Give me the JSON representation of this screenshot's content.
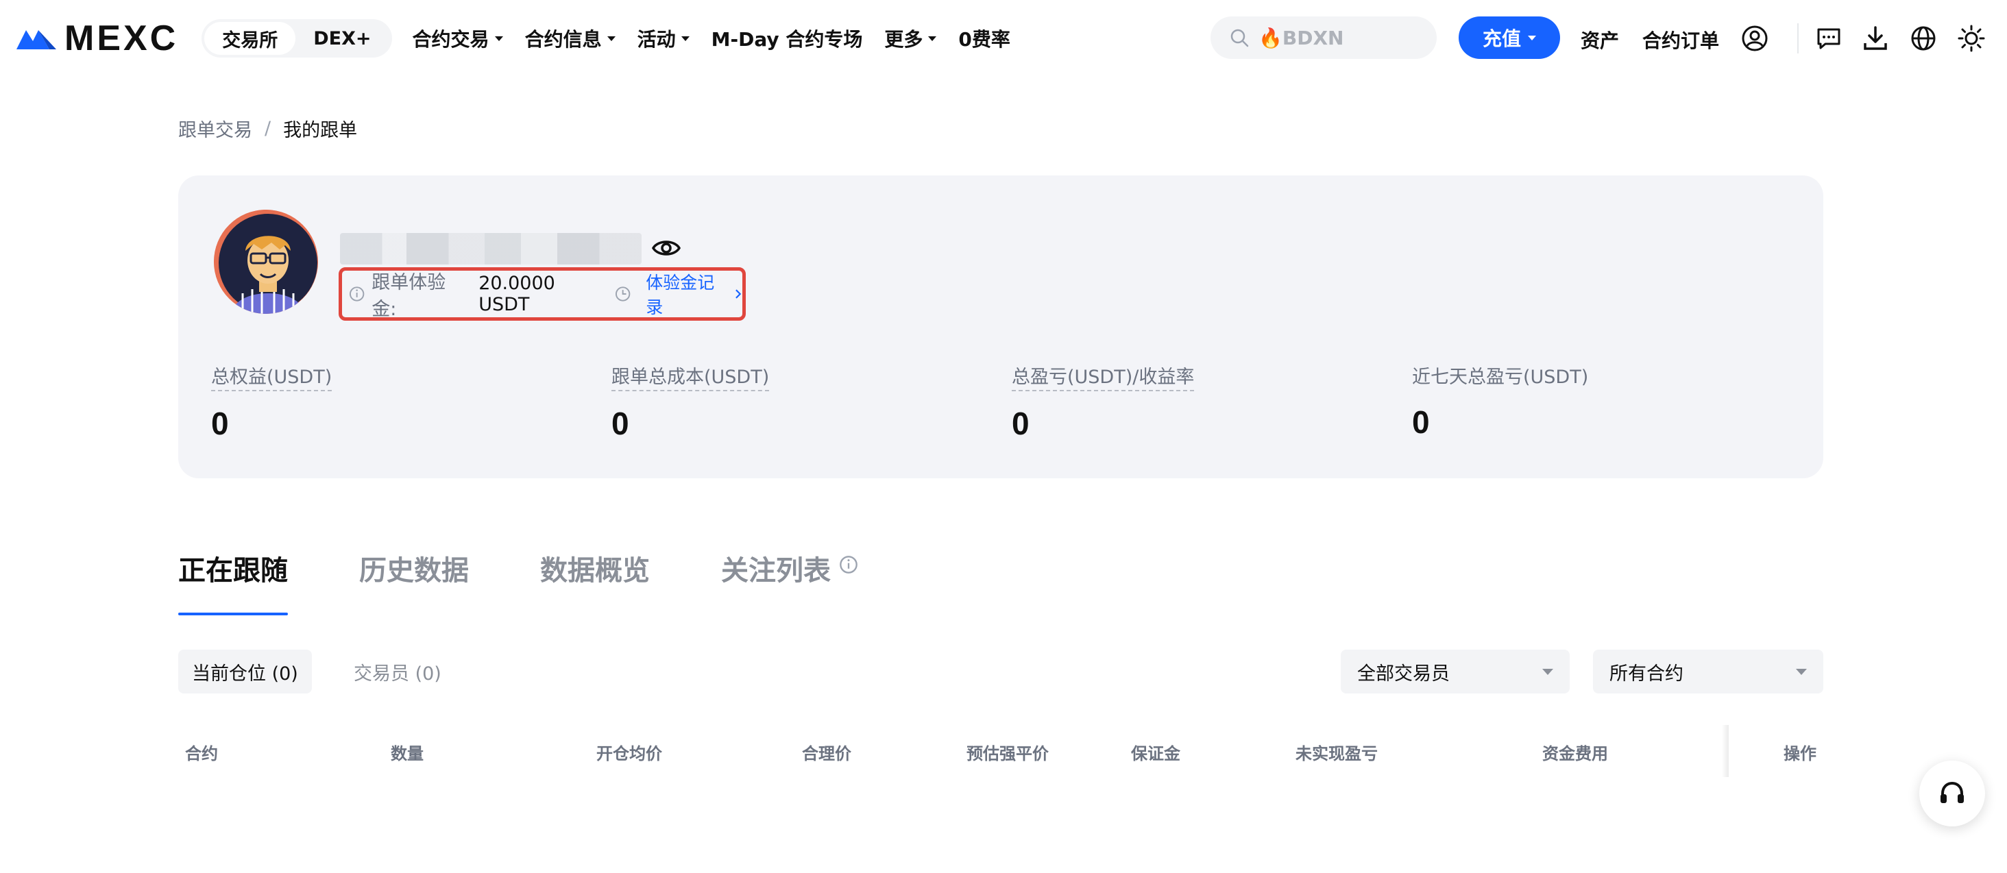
{
  "brand": {
    "name": "MEXC",
    "accent": "#1763ff",
    "highlight_border": "#e0463e"
  },
  "nav": {
    "segments": [
      {
        "label": "交易所",
        "active": true
      },
      {
        "label": "DEX+",
        "active": false
      }
    ],
    "menu": [
      {
        "label": "合约交易",
        "dropdown": true
      },
      {
        "label": "合约信息",
        "dropdown": true
      },
      {
        "label": "活动",
        "dropdown": true
      },
      {
        "label": "M-Day 合约专场",
        "dropdown": false
      },
      {
        "label": "更多",
        "dropdown": true
      },
      {
        "label": "0费率",
        "dropdown": false
      }
    ],
    "search_value": "🔥BDXN",
    "deposit_label": "充值",
    "assets_label": "资产",
    "orders_label": "合约订单",
    "icons": [
      "user-icon",
      "message-icon",
      "download-icon",
      "globe-icon",
      "sun-icon"
    ]
  },
  "breadcrumb": {
    "parent": "跟单交易",
    "separator": "/",
    "current": "我的跟单"
  },
  "profile": {
    "trial_label": "跟单体验金:",
    "trial_value": "20.0000 USDT",
    "trial_link": "体验金记录",
    "stats": [
      {
        "label": "总权益(USDT)",
        "value": "0"
      },
      {
        "label": "跟单总成本(USDT)",
        "value": "0"
      },
      {
        "label": "总盈亏(USDT)/收益率",
        "value": "0"
      },
      {
        "label": "近七天总盈亏(USDT)",
        "value": "0"
      }
    ]
  },
  "tabs": [
    {
      "label": "正在跟随",
      "active": true
    },
    {
      "label": "历史数据",
      "active": false
    },
    {
      "label": "数据概览",
      "active": false
    },
    {
      "label": "关注列表",
      "active": false
    }
  ],
  "subtabs": [
    {
      "label": "当前仓位 (0)",
      "active": true
    },
    {
      "label": "交易员 (0)",
      "active": false
    }
  ],
  "filters": {
    "traders": "全部交易员",
    "contracts": "所有合约"
  },
  "table": {
    "columns": [
      "合约",
      "数量",
      "开仓均价",
      "合理价",
      "预估强平价",
      "保证金",
      "未实现盈亏",
      "资金费用",
      "操作"
    ]
  }
}
